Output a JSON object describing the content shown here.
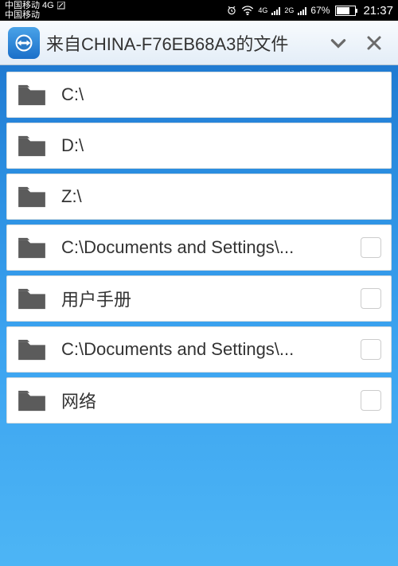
{
  "status": {
    "carrier_line1": "中国移动 4G",
    "carrier_line2": "中国移动",
    "net1": "4G",
    "net2": "2G",
    "battery_pct": "67%",
    "time": "21:37"
  },
  "header": {
    "title": "来自CHINA-F76EB68A3的文件"
  },
  "items": [
    {
      "label": "C:\\",
      "checkbox": false
    },
    {
      "label": "D:\\",
      "checkbox": false
    },
    {
      "label": "Z:\\",
      "checkbox": false
    },
    {
      "label": "C:\\Documents and Settings\\...",
      "checkbox": true
    },
    {
      "label": "用户手册",
      "checkbox": true
    },
    {
      "label": "C:\\Documents and Settings\\...",
      "checkbox": true
    },
    {
      "label": "网络",
      "checkbox": true
    }
  ]
}
